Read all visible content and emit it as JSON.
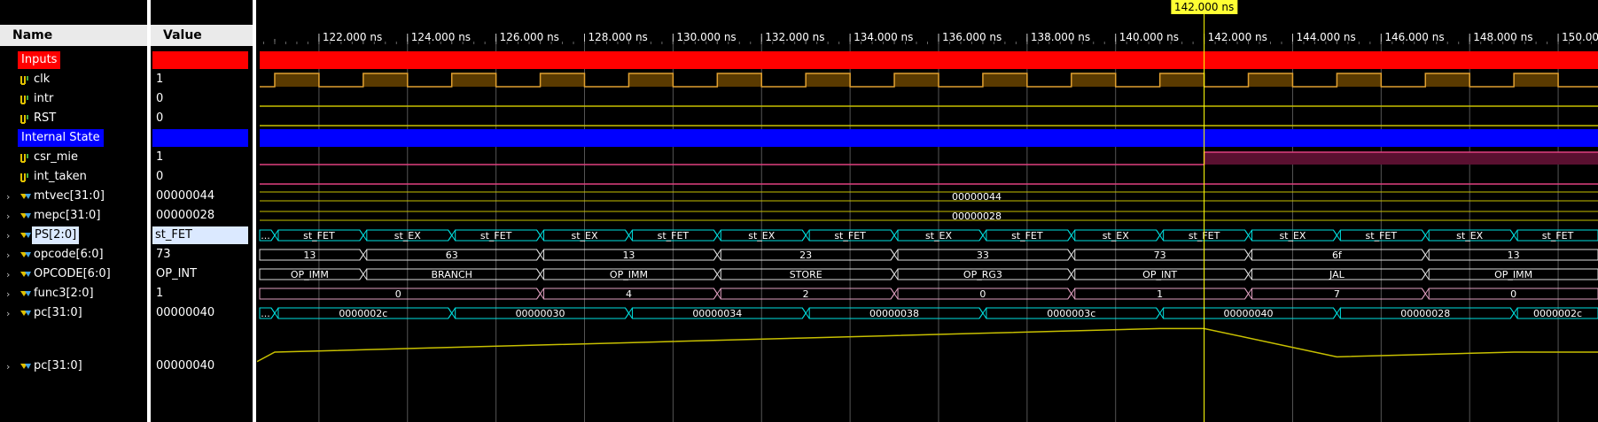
{
  "headers": {
    "name": "Name",
    "value": "Value"
  },
  "cursor": {
    "label": "142.000 ns",
    "time_ns": 142.0
  },
  "time_axis": {
    "start_ns": 120.6,
    "end_ns": 150.9,
    "tick_labels": [
      "122.000 ns",
      "124.000 ns",
      "126.000 ns",
      "128.000 ns",
      "130.000 ns",
      "132.000 ns",
      "134.000 ns",
      "136.000 ns",
      "138.000 ns",
      "140.000 ns",
      "142.000 ns",
      "144.000 ns",
      "146.000 ns",
      "148.000 ns",
      "150.000 ns"
    ],
    "tick_values_ns": [
      122,
      124,
      126,
      128,
      130,
      132,
      134,
      136,
      138,
      140,
      142,
      144,
      146,
      148,
      150
    ]
  },
  "colors": {
    "inputs_group": "#ff0000",
    "internal_group": "#0000ff",
    "clock_fill": "#5a3a00",
    "clock_line": "#e0a030",
    "bit_low_line": "#c8c000",
    "bus_line": "#00e0e0",
    "bus_text": "#ffffff",
    "csr_line": "#e04080",
    "cursor_line": "#ffff00",
    "analog_line": "#c8c000",
    "vertical_grid": "#555555"
  },
  "signals": [
    {
      "name": "Inputs",
      "value": "",
      "kind": "group",
      "icon": ""
    },
    {
      "name": "clk",
      "value": "1",
      "kind": "clock",
      "icon": "bit-signal-icon"
    },
    {
      "name": "intr",
      "value": "0",
      "kind": "bit",
      "icon": "bit-signal-icon"
    },
    {
      "name": "RST",
      "value": "0",
      "kind": "bit",
      "icon": "bit-signal-icon"
    },
    {
      "name": "Internal State",
      "value": "",
      "kind": "group",
      "icon": ""
    },
    {
      "name": "csr_mie",
      "value": "1",
      "kind": "bit",
      "icon": "bit-signal-icon"
    },
    {
      "name": "int_taken",
      "value": "0",
      "kind": "bit",
      "icon": "bit-signal-icon"
    },
    {
      "name": "mtvec[31:0]",
      "value": "00000044",
      "kind": "bus",
      "icon": "bus-signal-icon"
    },
    {
      "name": "mepc[31:0]",
      "value": "00000028",
      "kind": "bus",
      "icon": "bus-signal-icon"
    },
    {
      "name": "PS[2:0]",
      "value": "st_FET",
      "kind": "bus",
      "icon": "bus-signal-icon",
      "selected": true
    },
    {
      "name": "opcode[6:0]",
      "value": "73",
      "kind": "bus",
      "icon": "bus-signal-icon"
    },
    {
      "name": "OPCODE[6:0]",
      "value": "OP_INT",
      "kind": "bus",
      "icon": "bus-signal-icon"
    },
    {
      "name": "func3[2:0]",
      "value": "1",
      "kind": "bus",
      "icon": "bus-signal-icon"
    },
    {
      "name": "pc[31:0]",
      "value": "00000040",
      "kind": "bus",
      "icon": "bus-signal-icon"
    },
    {
      "name": "pc[31:0]",
      "value": "00000040",
      "kind": "analog",
      "icon": "bus-signal-icon"
    }
  ],
  "waves": {
    "clk_period_ns": 2.0,
    "clk_first_rise_ns": 121.0,
    "csr_mie_rise_ns": 142.0,
    "mtvec": {
      "label": "00000044"
    },
    "mepc": {
      "label": "00000028"
    },
    "ps": {
      "labels": [
        "...",
        "st_FET",
        "st_EX",
        "st_FET",
        "st_EX",
        "st_FET",
        "st_EX",
        "st_FET",
        "st_EX",
        "st_FET",
        "st_EX",
        "st_FET",
        "st_EX",
        "st_FET",
        "st_EX",
        "st_FET"
      ],
      "times_ns": [
        120.6,
        121.0,
        123.0,
        125.0,
        127.0,
        129.0,
        131.0,
        133.0,
        135.0,
        137.0,
        139.0,
        141.0,
        143.0,
        145.0,
        147.0,
        149.0
      ]
    },
    "opcode": {
      "labels": [
        "13",
        "63",
        "13",
        "23",
        "33",
        "73",
        "6f",
        "13"
      ],
      "times_ns": [
        120.6,
        123.0,
        127.0,
        131.0,
        135.0,
        139.0,
        143.0,
        147.0
      ]
    },
    "OPCODE": {
      "labels": [
        "OP_IMM",
        "BRANCH",
        "OP_IMM",
        "STORE",
        "OP_RG3",
        "OP_INT",
        "JAL",
        "OP_IMM"
      ],
      "times_ns": [
        120.6,
        123.0,
        127.0,
        131.0,
        135.0,
        139.0,
        143.0,
        147.0
      ]
    },
    "func3": {
      "labels": [
        "0",
        "4",
        "2",
        "0",
        "1",
        "7",
        "0"
      ],
      "times_ns": [
        120.6,
        127.0,
        131.0,
        135.0,
        139.0,
        143.0,
        147.0
      ]
    },
    "pc": {
      "labels": [
        "...",
        "0000002c",
        "00000030",
        "00000034",
        "00000038",
        "0000003c",
        "00000040",
        "00000028",
        "0000002c"
      ],
      "times_ns": [
        120.6,
        121.0,
        125.0,
        129.0,
        133.0,
        137.0,
        141.0,
        145.0,
        149.0
      ]
    },
    "pc_analog": {
      "times_ns": [
        120.6,
        121.0,
        125.0,
        129.0,
        133.0,
        137.0,
        141.0,
        142.0,
        145.0,
        149.0,
        150.9
      ],
      "values": [
        36,
        44,
        48,
        52,
        56,
        60,
        64,
        64,
        40,
        44,
        44
      ]
    }
  }
}
